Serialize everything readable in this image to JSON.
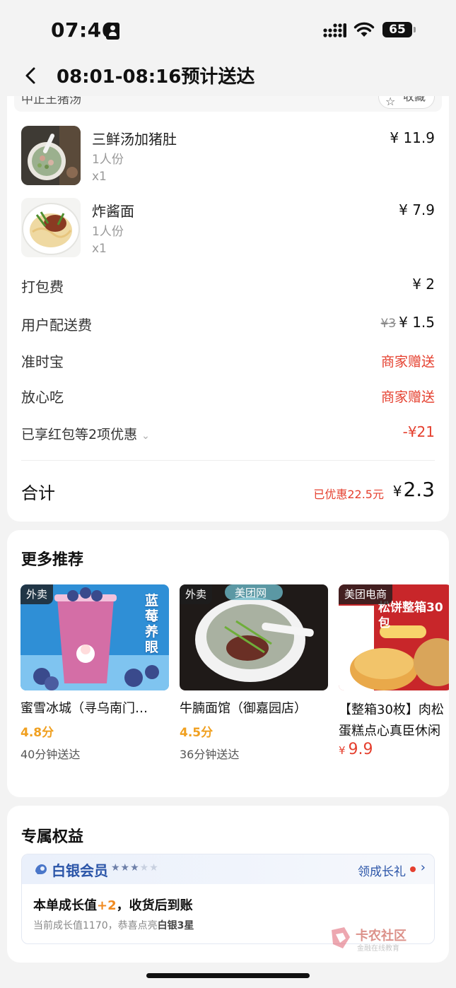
{
  "status_bar": {
    "time": "07:46",
    "battery": "65"
  },
  "header": {
    "title": "08:01-08:16预计送达"
  },
  "shop": {
    "name": "中正王猪汤",
    "fav_label": "收藏"
  },
  "items": [
    {
      "name": "三鲜汤加猪肚",
      "portion": "1人份",
      "qty": "x1",
      "price": "¥ 11.9"
    },
    {
      "name": "炸酱面",
      "portion": "1人份",
      "qty": "x1",
      "price": "¥ 7.9"
    }
  ],
  "fees": {
    "packing": {
      "label": "打包费",
      "value": "¥ 2"
    },
    "delivery": {
      "label": "用户配送费",
      "original": "¥3",
      "value": "¥ 1.5"
    },
    "ontime": {
      "label": "准时宝",
      "value": "商家赠送"
    },
    "safe": {
      "label": "放心吃",
      "value": "商家赠送"
    },
    "discount": {
      "label": "已享红包等2项优惠",
      "value": "-¥21"
    }
  },
  "total": {
    "label": "合计",
    "saved": "已优惠22.5元",
    "currency": "¥",
    "amount": "2.3"
  },
  "recommend": {
    "title": "更多推荐",
    "items": [
      {
        "tag": "外卖",
        "name": "蜜雪冰城（寻乌南门…",
        "score": "4.8分",
        "time": "40分钟送达",
        "img_text": "蓝莓养眼"
      },
      {
        "tag": "外卖",
        "name": "牛腩面馆（御嘉园店）",
        "score": "4.5分",
        "time": "36分钟送达",
        "img_text": "美团网"
      },
      {
        "tag": "美团电商",
        "name": "【整箱30枚】肉松",
        "name2": "蛋糕点心真臣休闲",
        "currency": "¥",
        "price": "9.9",
        "img_text": "松饼整箱30包"
      }
    ]
  },
  "benefits": {
    "title": "专属权益",
    "level": "白银会员",
    "link": "领成长礼",
    "line1_a": "本单成长值",
    "line1_plus": "+2",
    "line1_b": "，收货后到账",
    "line2_a": "当前成长值1170，恭喜点亮",
    "line2_b": "白银3星"
  },
  "watermark": {
    "text": "卡农社区",
    "sub": "金融在线教育"
  },
  "colors": {
    "accent_red": "#e5402f",
    "score_orange": "#f0a020",
    "member_blue": "#2b55a8"
  }
}
